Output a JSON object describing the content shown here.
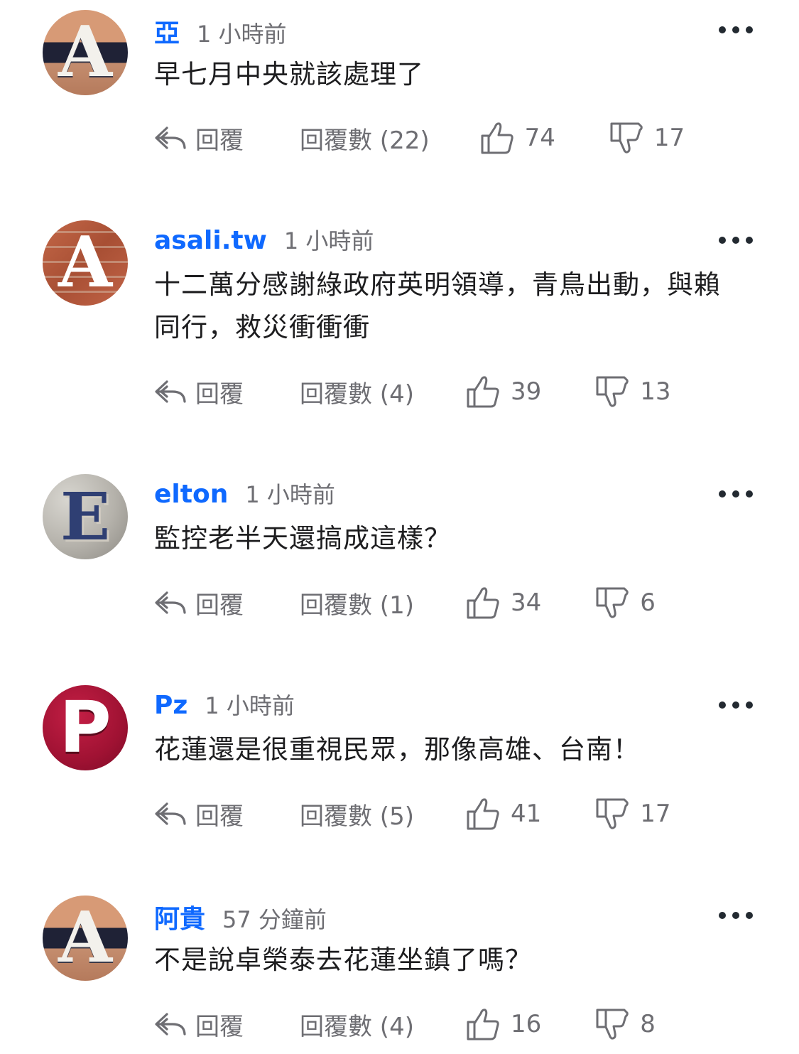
{
  "comments": [
    {
      "avatar_letter": "A",
      "username": "亞",
      "time": "1 小時前",
      "text": "早七月中央就該處理了",
      "reply_label": "回覆",
      "replies_label": "回覆數 (22)",
      "likes": "74",
      "dislikes": "17"
    },
    {
      "avatar_letter": "A",
      "username": "asali.tw",
      "time": "1 小時前",
      "text": "十二萬分感謝綠政府英明領導，青鳥出動，與賴同行，救災衝衝衝",
      "reply_label": "回覆",
      "replies_label": "回覆數 (4)",
      "likes": "39",
      "dislikes": "13"
    },
    {
      "avatar_letter": "E",
      "username": "elton",
      "time": "1 小時前",
      "text": "監控老半天還搞成這樣？",
      "reply_label": "回覆",
      "replies_label": "回覆數 (1)",
      "likes": "34",
      "dislikes": "6"
    },
    {
      "avatar_letter": "P",
      "username": "Pz",
      "time": "1 小時前",
      "text": "花蓮還是很重視民眾，那像高雄、台南！",
      "reply_label": "回覆",
      "replies_label": "回覆數 (5)",
      "likes": "41",
      "dislikes": "17"
    },
    {
      "avatar_letter": "A",
      "username": "阿貴",
      "time": "57 分鐘前",
      "text": "不是說卓榮泰去花蓮坐鎮了嗎？",
      "reply_label": "回覆",
      "replies_label": "回覆數 (4)",
      "likes": "16",
      "dislikes": "8"
    }
  ],
  "colors": {
    "username": "#0f69ff",
    "meta_gray": "#6e6e73",
    "text": "#1d1d1f"
  },
  "icons": [
    "reply-icon",
    "thumbs-up-icon",
    "thumbs-down-icon",
    "more-icon"
  ]
}
